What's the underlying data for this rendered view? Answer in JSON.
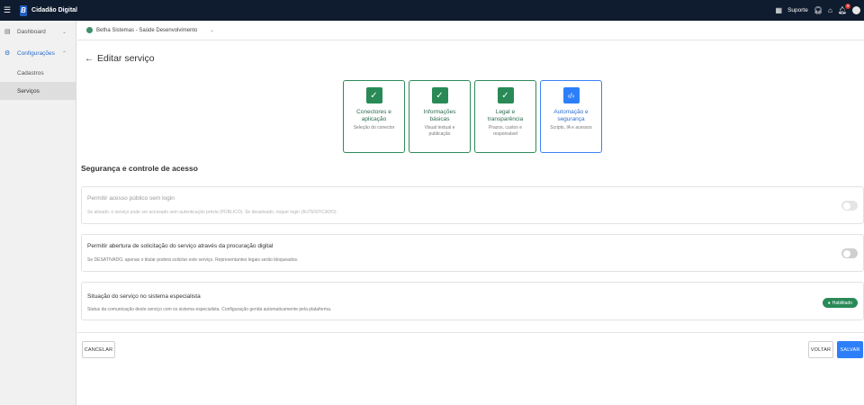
{
  "topbar": {
    "brand_logo": "B",
    "brand_name": "Cidadão Digital",
    "support_label": "Suporte",
    "notification_count": "9"
  },
  "sidebar": {
    "items": [
      {
        "label": "Dashboard"
      },
      {
        "label": "Configurações"
      }
    ],
    "subitems": [
      {
        "label": "Cadastros"
      },
      {
        "label": "Serviços"
      }
    ]
  },
  "breadcrumb": {
    "organization": "Betha Sistemas - Saúde Desenvolvimento"
  },
  "page": {
    "title": "Editar serviço"
  },
  "steps": [
    {
      "title": "Conectores e aplicação",
      "subtitle": "Seleção do conector",
      "icon": "check-icon",
      "status": "done"
    },
    {
      "title": "Informações básicas",
      "subtitle": "Visual textual e publicação",
      "icon": "check-icon",
      "status": "done"
    },
    {
      "title": "Legal e transparência",
      "subtitle": "Prazos, custos e responsável",
      "icon": "check-icon",
      "status": "done"
    },
    {
      "title": "Automação e segurança",
      "subtitle": "Scripts, IA e acessos",
      "icon": "code-icon",
      "status": "active"
    }
  ],
  "section": {
    "title": "Segurança e controle de acesso"
  },
  "settings": [
    {
      "title": "Permitir acesso público sem login",
      "description": "Se ativado, o serviço pode ser acessado sem autenticação prévia (PÚBLICO). Se desativado, requer login (AUTENTICADO).",
      "enabled": false,
      "disabled": true
    },
    {
      "title": "Permitir abertura de solicitação do serviço através da procuração digital",
      "description": "Se DESATIVADO, apenas o titular poderá solicitar este serviço. Representantes legais serão bloqueados.",
      "enabled": false,
      "disabled": false
    },
    {
      "title": "Situação do serviço no sistema especialista",
      "description": "Status da comunicação deste serviço com os sistema especialista. Configuração gerida automaticamente pela plataforma.",
      "status_label": "Habilitado"
    }
  ],
  "actions": {
    "cancel": "CANCELAR",
    "back": "VOLTAR",
    "save": "SALVAR"
  },
  "colors": {
    "topbar": "#0f1b2e",
    "success": "#2a8a57",
    "primary": "#2d7ff9"
  }
}
